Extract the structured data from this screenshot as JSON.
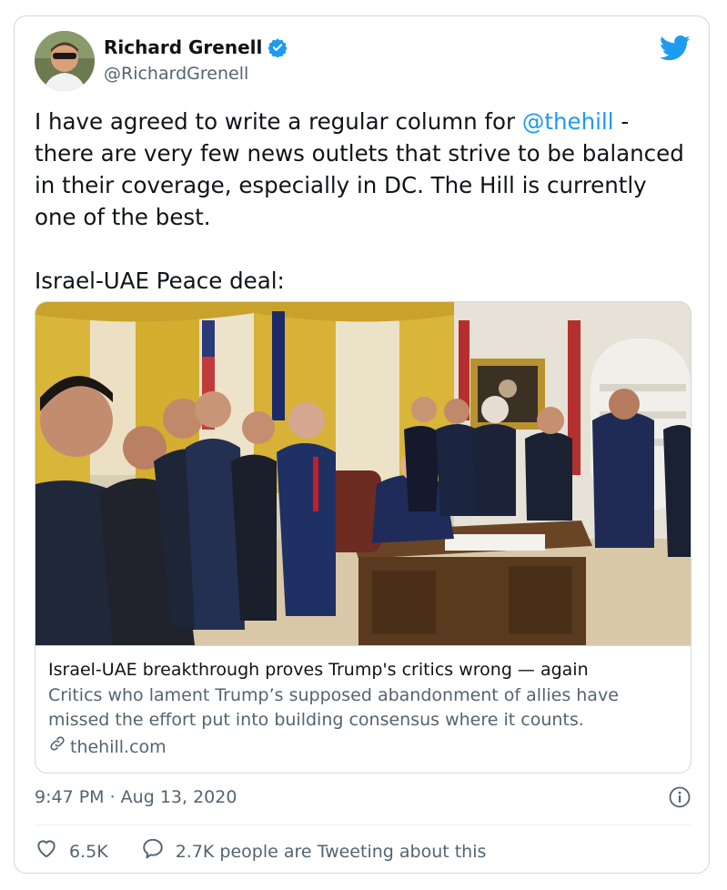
{
  "tweet": {
    "author_name": "Richard Grenell",
    "author_handle": "@RichardGrenell",
    "text_line1_pre": "I have agreed to write a regular column for ",
    "mention": "@thehill",
    "text_line1_post": " - there are very few news outlets that strive to be balanced in their coverage, especially in DC. The Hill is currently one of the best.",
    "text_para2": "Israel-UAE Peace deal:",
    "timestamp": "9:47 PM · Aug 13, 2020"
  },
  "link_card": {
    "title": "Israel-UAE breakthrough proves Trump's critics wrong — again",
    "description": "Critics who lament Trump’s supposed abandonment of allies have missed the effort put into building consensus where it counts.",
    "domain": "thehill.com"
  },
  "actions": {
    "likes": "6.5K",
    "tweeting": "2.7K people are Tweeting about this"
  },
  "colors": {
    "accent": "#1d9bf0",
    "secondary_text": "#536471",
    "border": "#cfd9de"
  },
  "icons": [
    "avatar-photo",
    "verified-badge-icon",
    "twitter-bird-icon",
    "link-icon",
    "info-icon",
    "heart-icon",
    "comment-bubble-icon"
  ]
}
